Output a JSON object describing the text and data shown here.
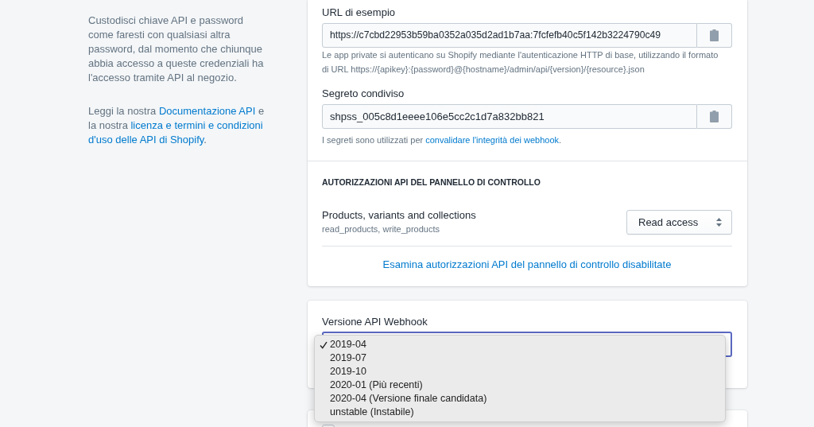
{
  "sidebar": {
    "paragraphs": [
      [
        {
          "kind": "text",
          "text": "Custodisci chiave API e password come faresti con qualsiasi altra password, dal momento che chiunque abbia accesso a queste credenziali ha l'accesso tramite API al negozio."
        }
      ],
      [
        {
          "kind": "text",
          "text": "Leggi la nostra "
        },
        {
          "kind": "link",
          "text": "Documentazione API"
        },
        {
          "kind": "text",
          "text": " e la nostra "
        },
        {
          "kind": "link",
          "text": "licenza e termini e condizioni"
        },
        {
          "kind": "link",
          "text": "d'uso delle API di Shopify"
        },
        {
          "kind": "text",
          "text": "."
        }
      ]
    ]
  },
  "credentials": {
    "fields": [
      {
        "label": "URL di esempio",
        "value": "https://c7cbd22953b59ba0352a035d2ad1b7aa:7fcfefb40c5f142b3224790c49",
        "help": [
          {
            "kind": "text",
            "text": "Le app private si autenticano su Shopify mediante l'autenticazione HTTP di base, utilizzando il formato di URL https://{apikey}:{password}@{hostname}/admin/api/{version}/{resource}.json"
          }
        ]
      },
      {
        "label": "Segreto condiviso",
        "value": "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",
        "help": [
          {
            "kind": "text",
            "text": "I segreti sono utilizzati per "
          },
          {
            "kind": "link",
            "text": "convalidare l'integrità dei webhook"
          },
          {
            "kind": "text",
            "text": "."
          }
        ]
      }
    ]
  },
  "permissions": {
    "heading": "AUTORIZZAZIONI API DEL PANNELLO DI CONTROLLO",
    "items": [
      {
        "name": "Products, variants and collections",
        "scopes": "read_products, write_products",
        "access": "Read access"
      }
    ],
    "link": "Esamina autorizzazioni API del pannello di controllo disabilitate"
  },
  "webhook": {
    "label": "Versione API Webhook",
    "focused": true,
    "menu": {
      "open": true,
      "options": [
        {
          "label": "2019-04",
          "selected": true
        },
        {
          "label": "2019-07",
          "selected": false
        },
        {
          "label": "2019-10",
          "selected": false
        },
        {
          "label": "2020-01 (Più recenti)",
          "selected": false
        },
        {
          "label": "2020-04 (Versione finale candidata)",
          "selected": false
        },
        {
          "label": "unstable (Instabile)",
          "selected": false
        }
      ]
    }
  },
  "next_card": {
    "checkbox": {
      "checked": false
    }
  }
}
